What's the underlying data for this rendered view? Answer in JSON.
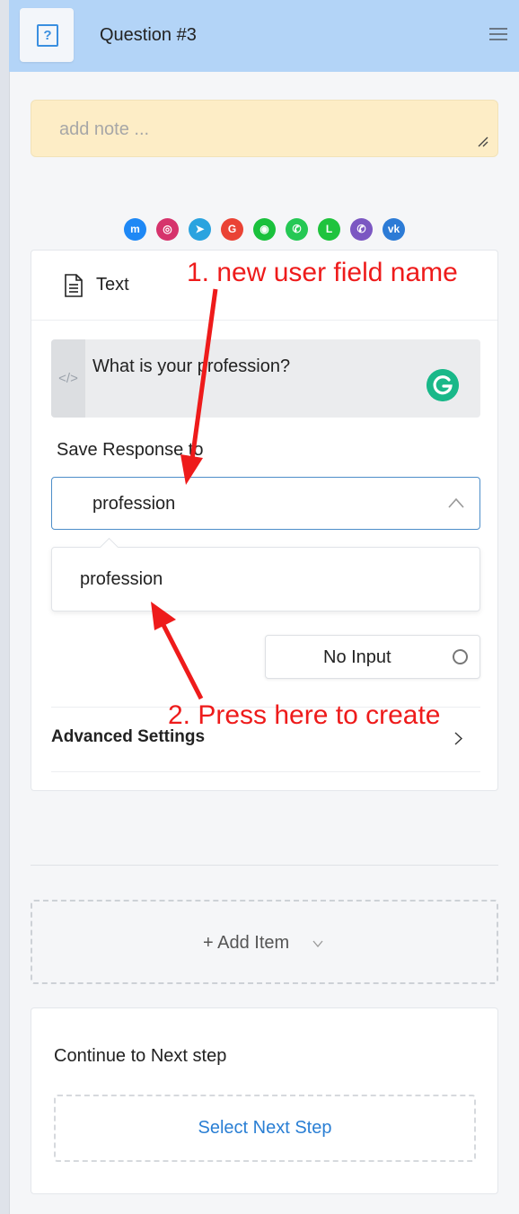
{
  "header": {
    "title": "Question #3",
    "question_icon_glyph": "?"
  },
  "note": {
    "placeholder": "add note ..."
  },
  "channels": [
    {
      "name": "messenger-icon",
      "color": "#1e88f5",
      "glyph": "m"
    },
    {
      "name": "instagram-icon",
      "color": "#d6336c",
      "glyph": "◎"
    },
    {
      "name": "telegram-icon",
      "color": "#2aa3df",
      "glyph": "➤"
    },
    {
      "name": "google-icon",
      "color": "#ea4335",
      "glyph": "G"
    },
    {
      "name": "wechat-icon",
      "color": "#1ac13c",
      "glyph": "◉"
    },
    {
      "name": "whatsapp-icon",
      "color": "#25c854",
      "glyph": "✆"
    },
    {
      "name": "line-icon",
      "color": "#1fc33d",
      "glyph": "L"
    },
    {
      "name": "viber-icon",
      "color": "#7b57c2",
      "glyph": "✆"
    },
    {
      "name": "vk-icon",
      "color": "#2c7bd6",
      "glyph": "vk"
    }
  ],
  "card": {
    "type_label": "Text",
    "question_text": "What is your profession?",
    "code_glyph": "</>",
    "save_label": "Save Response to",
    "select_value": "profession",
    "dropdown_option": "profession",
    "no_input_label": "No Input",
    "advanced_label": "Advanced Settings"
  },
  "add_item": {
    "label": "+ Add Item"
  },
  "next_step": {
    "title": "Continue to Next step",
    "button_label": "Select Next Step"
  },
  "annotations": {
    "first": "1. new user field name",
    "second": "2. Press here to create",
    "color": "#ee1b1b"
  },
  "colors": {
    "header_bg": "#b3d4f7",
    "note_bg": "#fdedc6",
    "accent": "#2a7fd4",
    "grammarly": "#19b889"
  }
}
